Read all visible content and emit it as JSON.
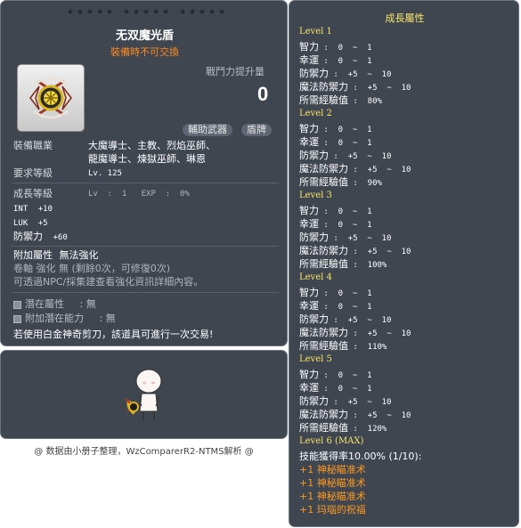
{
  "item_id": "01092092",
  "item": {
    "name": "无双魔光盾",
    "trade_status": "裝備時不可交換",
    "power_increase_label": "戰鬥力提升量",
    "power_increase_value": "0",
    "tags": [
      "輔助武器",
      "盾牌"
    ],
    "job_label": "裝備職業",
    "jobs": [
      "大魔導士、主教、烈焰巫師、",
      "龍魔導士、煉獄巫師、琳恩"
    ],
    "req_level_label": "要求等級",
    "req_level_value": "Lv. 125",
    "growth_label": "成長等級",
    "growth_value": "Lv  :  1   EXP  :  0%",
    "stats": [
      {
        "label": "INT",
        "value": "+10"
      },
      {
        "label": "LUK",
        "value": "+5"
      },
      {
        "label": "防禦力",
        "value": "+60"
      }
    ],
    "extra_attr_label": "附加屬性",
    "extra_attr_value": "無法強化",
    "scroll_line": "卷軸 強化 無 (剩餘0次，可修復0次)",
    "npc_line": "可透過NPC/採集建查看強化資訊詳細內容。",
    "potential_label": "潛在屬性",
    "potential_value": ":  無",
    "add_potential_label": "附加潛在能力",
    "add_potential_value": ":  無",
    "scissors_note": "若使用白金神奇剪刀，該道具可進行一次交易!"
  },
  "growth": {
    "title": "成長屬性",
    "levels": [
      {
        "label": "Level 1",
        "lines": [
          {
            "name": "智力",
            "val": " :  0  ~  1"
          },
          {
            "name": "幸運",
            "val": " :  0  ~  1"
          },
          {
            "name": "防禦力",
            "val": " :  +5  ~  10"
          },
          {
            "name": "魔法防禦力",
            "val": " :  +5  ~  10"
          },
          {
            "name": "所需經驗值",
            "val": " :  80%"
          }
        ]
      },
      {
        "label": "Level 2",
        "lines": [
          {
            "name": "智力",
            "val": " :  0  ~  1"
          },
          {
            "name": "幸運",
            "val": " :  0  ~  1"
          },
          {
            "name": "防禦力",
            "val": " :  +5  ~  10"
          },
          {
            "name": "魔法防禦力",
            "val": " :  +5  ~  10"
          },
          {
            "name": "所需經驗值",
            "val": " :  90%"
          }
        ]
      },
      {
        "label": "Level 3",
        "lines": [
          {
            "name": "智力",
            "val": " :  0  ~  1"
          },
          {
            "name": "幸運",
            "val": " :  0  ~  1"
          },
          {
            "name": "防禦力",
            "val": " :  +5  ~  10"
          },
          {
            "name": "魔法防禦力",
            "val": " :  +5  ~  10"
          },
          {
            "name": "所需經驗值",
            "val": " :  100%"
          }
        ]
      },
      {
        "label": "Level 4",
        "lines": [
          {
            "name": "智力",
            "val": " :  0  ~  1"
          },
          {
            "name": "幸運",
            "val": " :  0  ~  1"
          },
          {
            "name": "防禦力",
            "val": " :  +5  ~  10"
          },
          {
            "name": "魔法防禦力",
            "val": " :  +5  ~  10"
          },
          {
            "name": "所需經驗值",
            "val": " :  110%"
          }
        ]
      },
      {
        "label": "Level 5",
        "lines": [
          {
            "name": "智力",
            "val": " :  0  ~  1"
          },
          {
            "name": "幸運",
            "val": " :  0  ~  1"
          },
          {
            "name": "防禦力",
            "val": " :  +5  ~  10"
          },
          {
            "name": "魔法防禦力",
            "val": " :  +5  ~  10"
          },
          {
            "name": "所需經驗值",
            "val": " :  120%"
          }
        ]
      }
    ],
    "max_label": "Level 6 (MAX)",
    "skill_rate": "技能獲得率10.00% (1/10):",
    "skills": [
      "+1 神秘瞄准术",
      "+1 神秘瞄准术",
      "+1 神秘瞄准术",
      "+1 玛瑙的祝福"
    ]
  },
  "footer": "@ 数据由小册子整理，WzComparerR2-NTMS解析 @",
  "icons": {
    "item": "shield-item-icon",
    "avatar": "character-avatar-icon",
    "star": "star-icon"
  },
  "colors": {
    "panel": "#3f4650",
    "orange": "#ff8a1f",
    "yellow": "#f6e56a"
  }
}
